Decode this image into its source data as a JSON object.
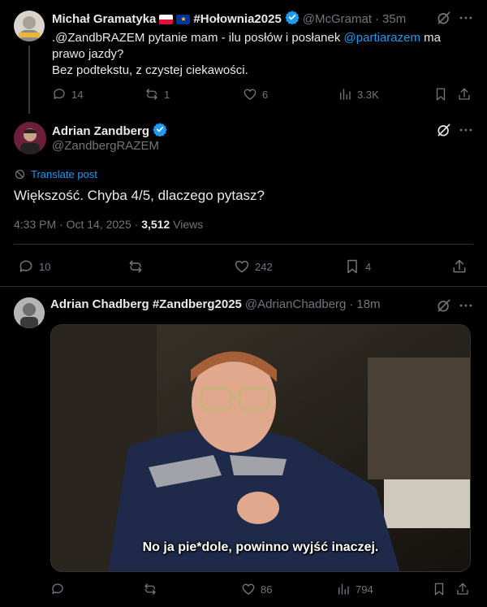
{
  "tweet1": {
    "author_name": "Michał Gramatyka",
    "hashtag": "#Hołownia2025",
    "handle": "@McGramat",
    "time": "35m",
    "text_part1": ".@ZandbRAZEM pytanie mam - ilu posłów i posłanek ",
    "mention": "@partiarazem",
    "text_part2": " ma prawo jazdy?",
    "text_line2": "Bez podtekstu, z czystej ciekawości.",
    "replies": "14",
    "reposts": "1",
    "likes": "6",
    "views": "3.3K"
  },
  "tweet2": {
    "author_name": "Adrian Zandberg",
    "handle": "@ZandbergRAZEM",
    "translate_label": "Translate post",
    "text": "Większość. Chyba 4/5, dlaczego pytasz?",
    "timestamp": "4:33 PM · Oct 14, 2025 · ",
    "views_count": "3,512",
    "views_label": " Views",
    "replies": "10",
    "likes": "242",
    "bookmarks": "4"
  },
  "tweet3": {
    "author_name": "Adrian Chadberg #Zandberg2025",
    "handle": "@AdrianChadberg",
    "time": "18m",
    "subtitle": "No ja pie*dole, powinno wyjść inaczej.",
    "likes": "86",
    "views": "794"
  },
  "icons": [
    "grok-icon",
    "more-icon",
    "reply-icon",
    "repost-icon",
    "like-icon",
    "views-icon",
    "bookmark-icon",
    "share-icon",
    "verified-icon",
    "translate-icon"
  ],
  "colors": {
    "accent": "#1d9bf0",
    "muted": "#71767b",
    "text": "#e7e9ea",
    "bg": "#000000"
  }
}
